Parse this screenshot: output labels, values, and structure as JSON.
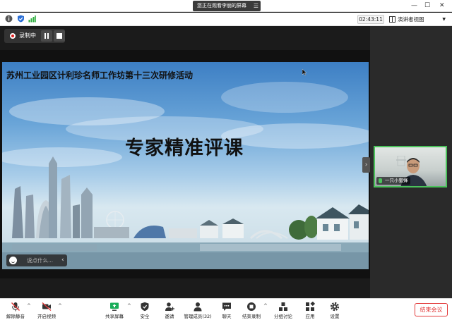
{
  "titlebar": {
    "share_banner": "您正在观看李丽的屏幕",
    "minimize": "—",
    "maximize": "☐",
    "close": "✕"
  },
  "infobar": {
    "timer": "02:43:11",
    "view_label": "演讲者视图"
  },
  "recording": {
    "label": "录制中"
  },
  "slide": {
    "heading": "苏州工业园区计利珍名师工作坊第十三次研修活动",
    "title": "专家精准评课"
  },
  "chat": {
    "placeholder": "说点什么..."
  },
  "video": {
    "participant_name": "一只小蜜蜂"
  },
  "toolbar": {
    "items": [
      {
        "label": "解除静音",
        "icon": "mic-muted-icon"
      },
      {
        "label": "开启视频",
        "icon": "video-off-icon"
      },
      {
        "label": "共享屏幕",
        "icon": "share-screen-icon"
      },
      {
        "label": "安全",
        "icon": "shield-icon"
      },
      {
        "label": "邀请",
        "icon": "invite-icon"
      },
      {
        "label": "管理成员(32)",
        "icon": "members-icon"
      },
      {
        "label": "聊天",
        "icon": "chat-icon"
      },
      {
        "label": "结束录制",
        "icon": "record-stop-icon"
      },
      {
        "label": "分组讨论",
        "icon": "breakout-icon"
      },
      {
        "label": "应用",
        "icon": "apps-icon"
      },
      {
        "label": "设置",
        "icon": "settings-icon"
      }
    ],
    "end_meeting": "结束会议"
  },
  "colors": {
    "accent_green": "#4bc25b",
    "end_red": "#e23a3a",
    "share_green": "#1aad5a"
  }
}
